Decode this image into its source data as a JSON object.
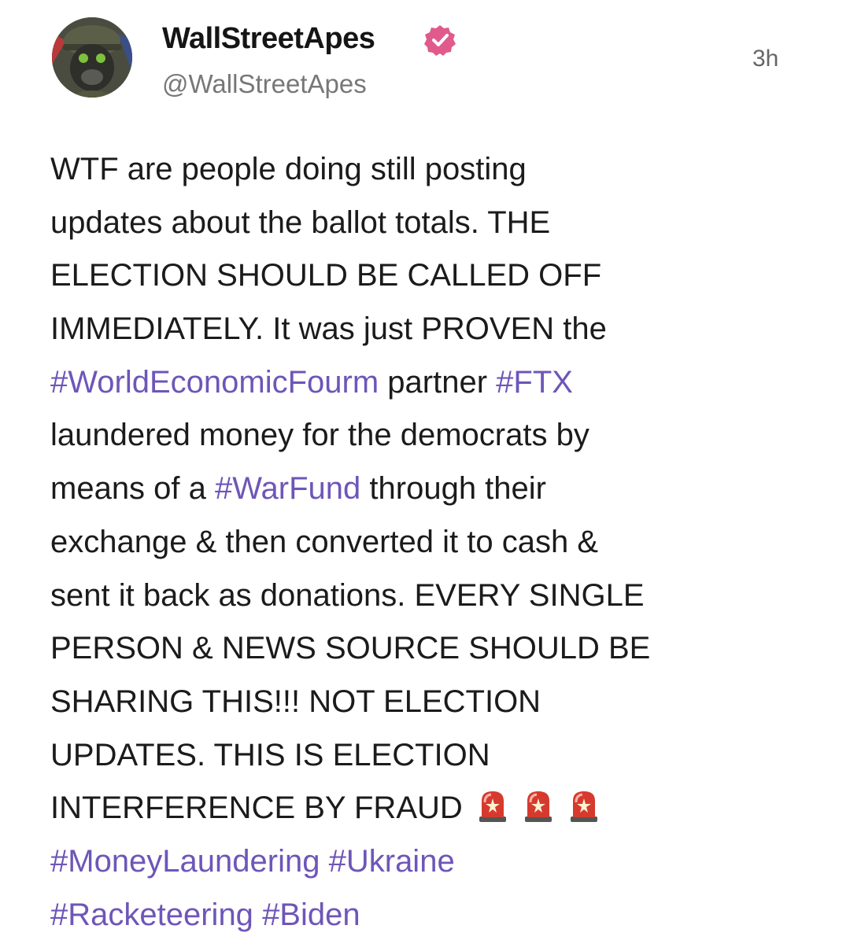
{
  "post": {
    "author": {
      "display_name": "WallStreetApes",
      "handle": "@WallStreetApes",
      "verified": true,
      "avatar_icon": "gorilla-soldier-avatar"
    },
    "timestamp": "3h",
    "body_lines": [
      [
        {
          "t": "WTF are people doing still posting"
        }
      ],
      [
        {
          "t": "updates about the ballot totals. THE"
        }
      ],
      [
        {
          "t": "ELECTION SHOULD BE CALLED OFF"
        }
      ],
      [
        {
          "t": "IMMEDIATELY. It was just PROVEN the"
        }
      ],
      [
        {
          "t": "#WorldEconomicFourm",
          "tag": true
        },
        {
          "t": " partner "
        },
        {
          "t": "#FTX",
          "tag": true
        }
      ],
      [
        {
          "t": "laundered money for the democrats by"
        }
      ],
      [
        {
          "t": "means of a "
        },
        {
          "t": "#WarFund",
          "tag": true
        },
        {
          "t": " through their"
        }
      ],
      [
        {
          "t": "exchange & then converted it to cash &"
        }
      ],
      [
        {
          "t": "sent it back as donations. EVERY SINGLE"
        }
      ],
      [
        {
          "t": "PERSON & NEWS SOURCE SHOULD BE"
        }
      ],
      [
        {
          "t": "SHARING THIS!!! NOT ELECTION"
        }
      ],
      [
        {
          "t": "UPDATES. THIS IS ELECTION"
        }
      ],
      [
        {
          "t": "INTERFERENCE BY FRAUD"
        },
        {
          "emoji": "police-siren-icon",
          "count": 3
        }
      ],
      [
        {
          "t": "#MoneyLaundering",
          "tag": true
        },
        {
          "t": " "
        },
        {
          "t": "#Ukraine",
          "tag": true
        }
      ],
      [
        {
          "t": "#Racketeering",
          "tag": true
        },
        {
          "t": " "
        },
        {
          "t": "#Biden",
          "tag": true
        }
      ]
    ]
  },
  "colors": {
    "hashtag": "#6e56b8",
    "verified_badge": "#e05a8c",
    "text": "#1b1b1b",
    "handle": "#777777"
  }
}
